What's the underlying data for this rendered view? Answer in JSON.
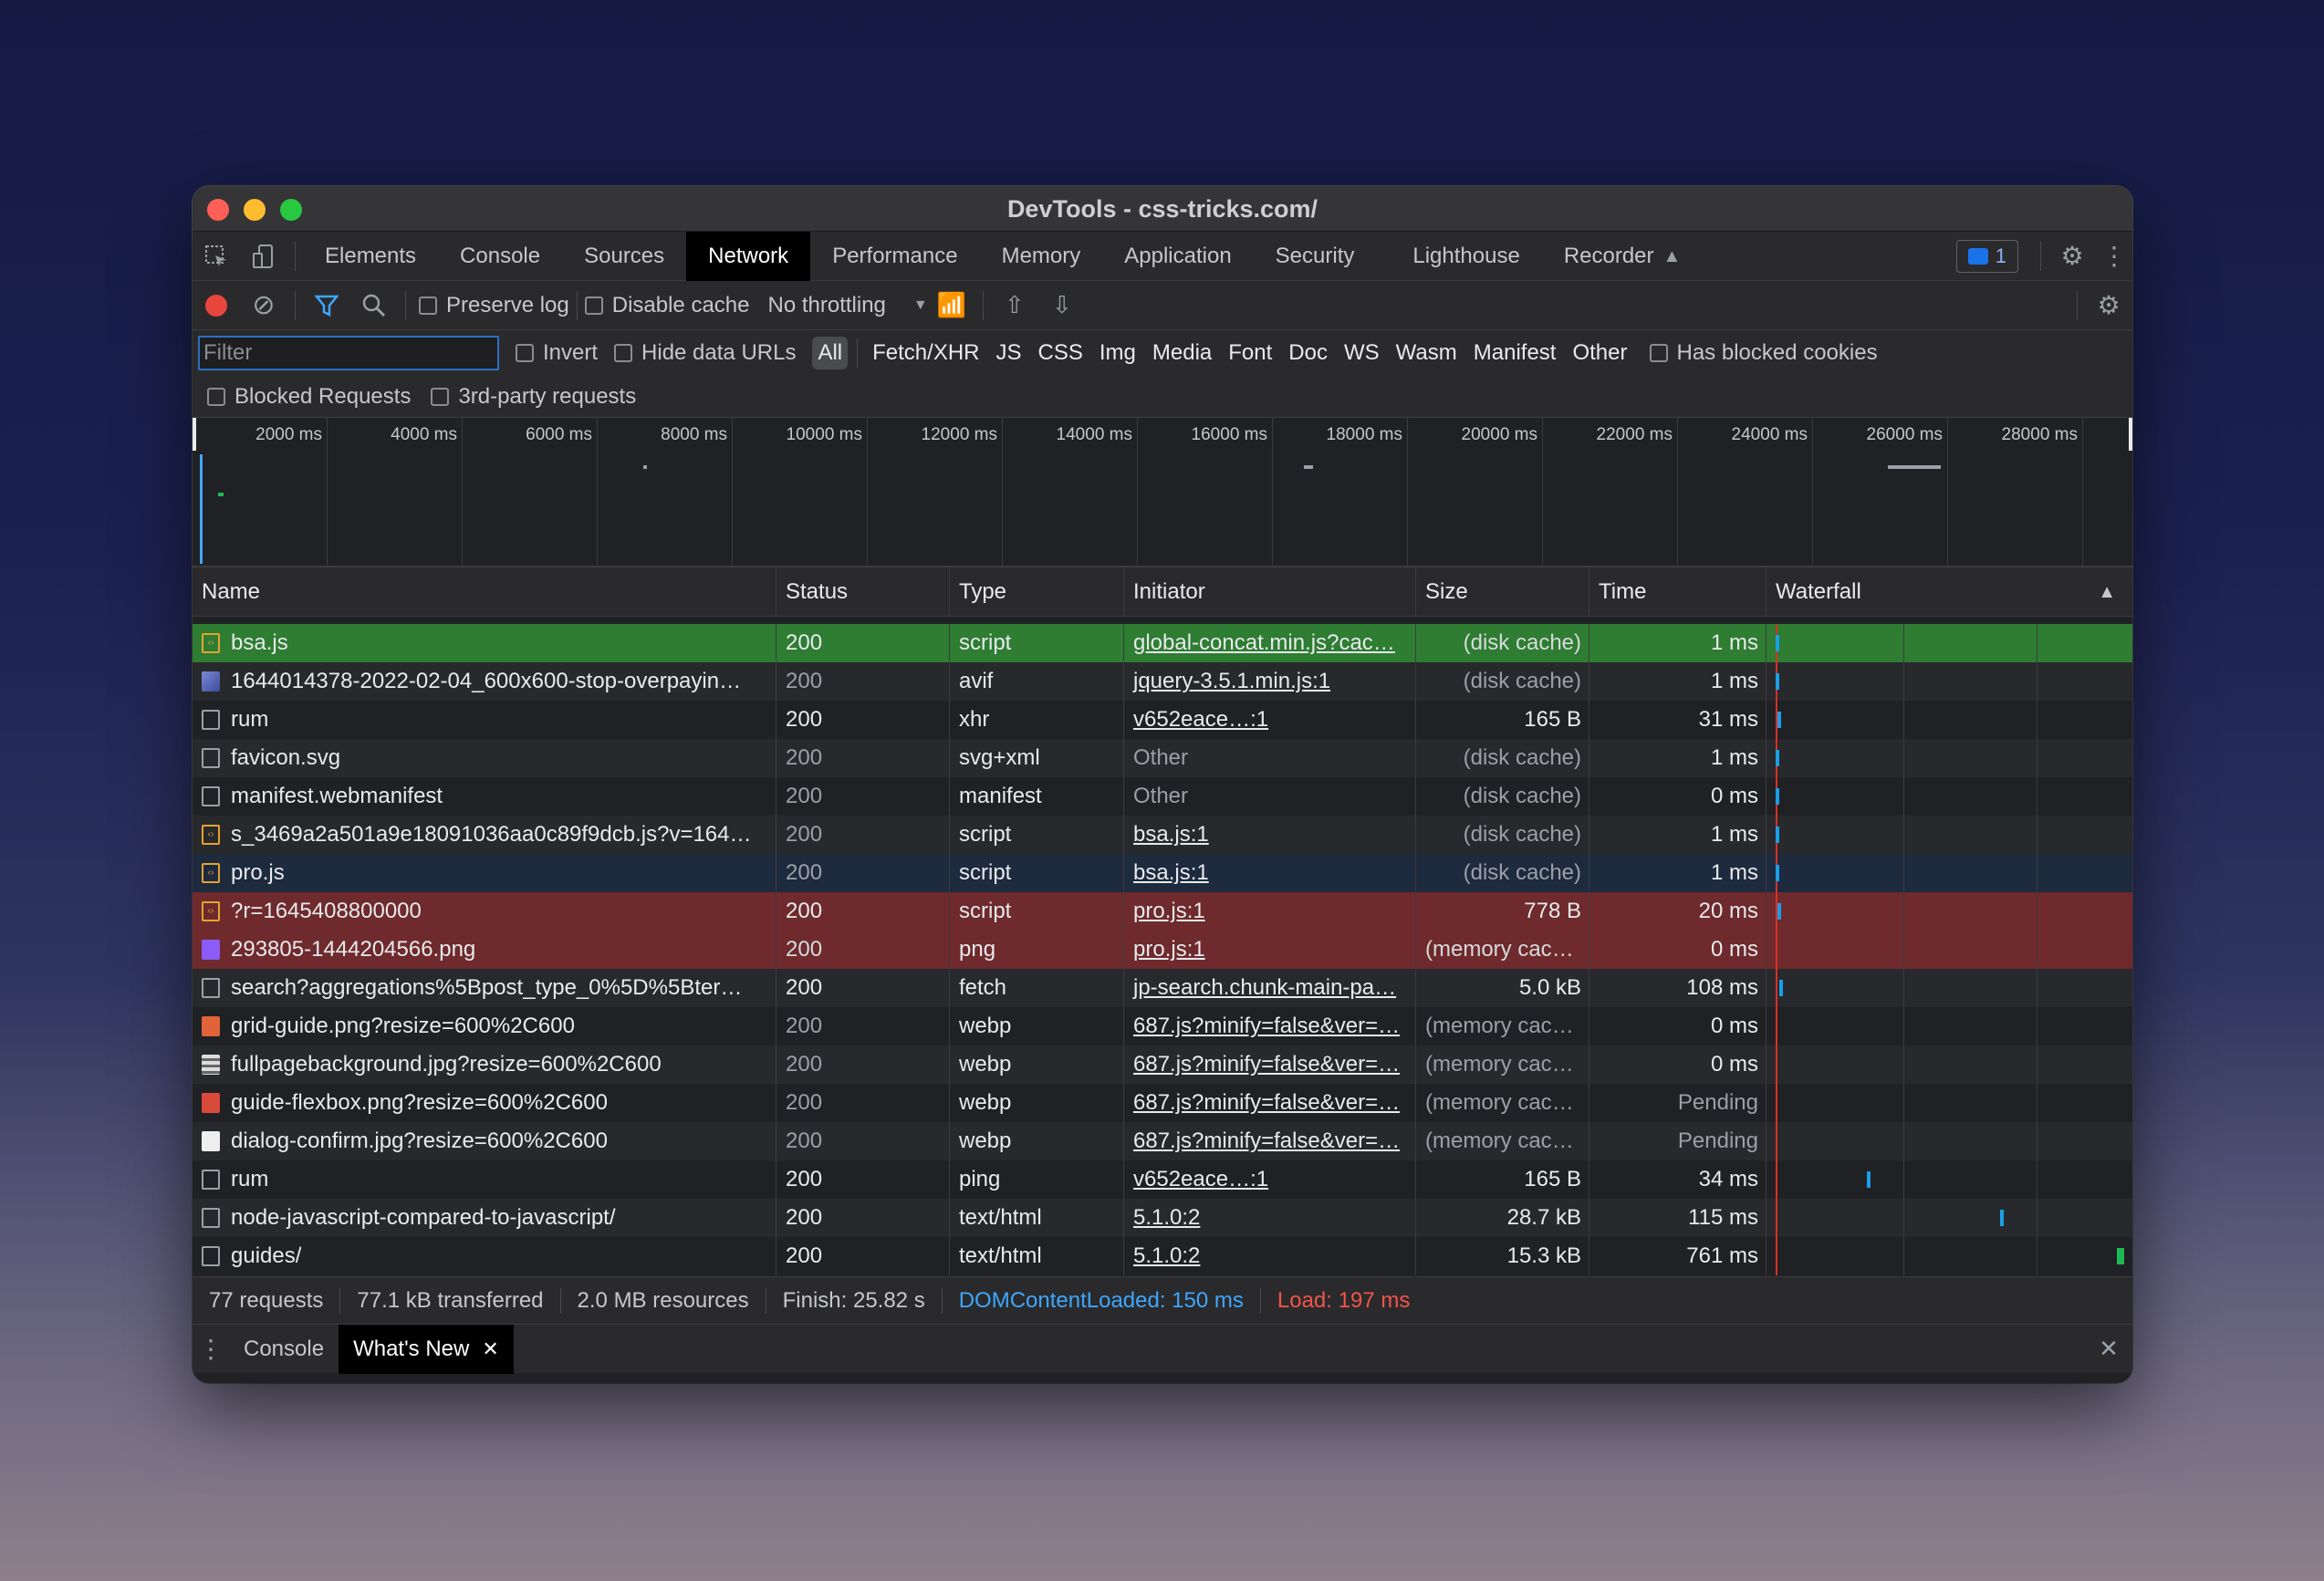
{
  "window": {
    "title": "DevTools - css-tricks.com/"
  },
  "tabs": {
    "items": [
      "Elements",
      "Console",
      "Sources",
      "Network",
      "Performance",
      "Memory",
      "Application",
      "Security",
      "Lighthouse",
      "Recorder"
    ],
    "active": "Network",
    "issues_count": "1"
  },
  "toolbar": {
    "preserve_log": "Preserve log",
    "disable_cache": "Disable cache",
    "throttling": "No throttling"
  },
  "filter": {
    "placeholder": "Filter",
    "invert": "Invert",
    "hide_data_urls": "Hide data URLs",
    "types": [
      "All",
      "Fetch/XHR",
      "JS",
      "CSS",
      "Img",
      "Media",
      "Font",
      "Doc",
      "WS",
      "Wasm",
      "Manifest",
      "Other"
    ],
    "active_type": "All",
    "has_blocked_cookies": "Has blocked cookies",
    "blocked_requests": "Blocked Requests",
    "third_party": "3rd-party requests"
  },
  "overview": {
    "ticks": [
      "2000 ms",
      "4000 ms",
      "6000 ms",
      "8000 ms",
      "10000 ms",
      "12000 ms",
      "14000 ms",
      "16000 ms",
      "18000 ms",
      "20000 ms",
      "22000 ms",
      "24000 ms",
      "26000 ms",
      "28000 ms"
    ]
  },
  "table": {
    "headers": [
      "Name",
      "Status",
      "Type",
      "Initiator",
      "Size",
      "Time",
      "Waterfall"
    ],
    "rows": [
      {
        "name": "bsa.js",
        "status": "200",
        "type": "script",
        "initiator": "global-concat.min.js?cac…",
        "size": "(disk cache)",
        "time": "1 ms",
        "icon": "script",
        "state": "selected"
      },
      {
        "name": "1644014378-2022-02-04_600x600-stop-overpayin…",
        "status": "200",
        "type": "avif",
        "initiator": "jquery-3.5.1.min.js:1",
        "size": "(disk cache)",
        "time": "1 ms",
        "icon": "img",
        "state": ""
      },
      {
        "name": "rum",
        "status": "200",
        "type": "xhr",
        "initiator": "v652eace…:1",
        "size": "165 B",
        "time": "31 ms",
        "icon": "doc",
        "state": ""
      },
      {
        "name": "favicon.svg",
        "status": "200",
        "type": "svg+xml",
        "initiator": "Other",
        "size": "(disk cache)",
        "time": "1 ms",
        "icon": "doc",
        "state": ""
      },
      {
        "name": "manifest.webmanifest",
        "status": "200",
        "type": "manifest",
        "initiator": "Other",
        "size": "(disk cache)",
        "time": "0 ms",
        "icon": "doc",
        "state": ""
      },
      {
        "name": "s_3469a2a501a9e18091036aa0c89f9dcb.js?v=164…",
        "status": "200",
        "type": "script",
        "initiator": "bsa.js:1",
        "size": "(disk cache)",
        "time": "1 ms",
        "icon": "script",
        "state": ""
      },
      {
        "name": "pro.js",
        "status": "200",
        "type": "script",
        "initiator": "bsa.js:1",
        "size": "(disk cache)",
        "time": "1 ms",
        "icon": "script",
        "state": "focused"
      },
      {
        "name": "?r=1645408800000",
        "status": "200",
        "type": "script",
        "initiator": "pro.js:1",
        "size": "778 B",
        "time": "20 ms",
        "icon": "script",
        "state": "blocked"
      },
      {
        "name": "293805-1444204566.png",
        "status": "200",
        "type": "png",
        "initiator": "pro.js:1",
        "size": "(memory cache)",
        "time": "0 ms",
        "icon": "img2",
        "state": "blocked"
      },
      {
        "name": "search?aggregations%5Bpost_type_0%5D%5Bter…",
        "status": "200",
        "type": "fetch",
        "initiator": "jp-search.chunk-main-pa…",
        "size": "5.0 kB",
        "time": "108 ms",
        "icon": "doc",
        "state": ""
      },
      {
        "name": "grid-guide.png?resize=600%2C600",
        "status": "200",
        "type": "webp",
        "initiator": "687.js?minify=false&ver=…",
        "size": "(memory cache)",
        "time": "0 ms",
        "icon": "img3",
        "state": ""
      },
      {
        "name": "fullpagebackground.jpg?resize=600%2C600",
        "status": "200",
        "type": "webp",
        "initiator": "687.js?minify=false&ver=…",
        "size": "(memory cache)",
        "time": "0 ms",
        "icon": "img4",
        "state": ""
      },
      {
        "name": "guide-flexbox.png?resize=600%2C600",
        "status": "200",
        "type": "webp",
        "initiator": "687.js?minify=false&ver=…",
        "size": "(memory cache)",
        "time": "Pending",
        "icon": "img5",
        "state": ""
      },
      {
        "name": "dialog-confirm.jpg?resize=600%2C600",
        "status": "200",
        "type": "webp",
        "initiator": "687.js?minify=false&ver=…",
        "size": "(memory cache)",
        "time": "Pending",
        "icon": "img6",
        "state": ""
      },
      {
        "name": "rum",
        "status": "200",
        "type": "ping",
        "initiator": "v652eace…:1",
        "size": "165 B",
        "time": "34 ms",
        "icon": "doc",
        "state": ""
      },
      {
        "name": "node-javascript-compared-to-javascript/",
        "status": "200",
        "type": "text/html",
        "initiator": "5.1.0:2",
        "size": "28.7 kB",
        "time": "115 ms",
        "icon": "doc",
        "state": ""
      },
      {
        "name": "guides/",
        "status": "200",
        "type": "text/html",
        "initiator": "5.1.0:2",
        "size": "15.3 kB",
        "time": "761 ms",
        "icon": "doc",
        "state": ""
      }
    ]
  },
  "summary": {
    "requests": "77 requests",
    "transferred": "77.1 kB transferred",
    "resources": "2.0 MB resources",
    "finish": "Finish: 25.82 s",
    "dom_content_loaded": "DOMContentLoaded: 150 ms",
    "load": "Load: 197 ms",
    "dcl_color": "#3ea6ff",
    "load_color": "#f2544a"
  },
  "drawer": {
    "tabs": [
      "Console",
      "What's New"
    ],
    "active": "What's New"
  }
}
